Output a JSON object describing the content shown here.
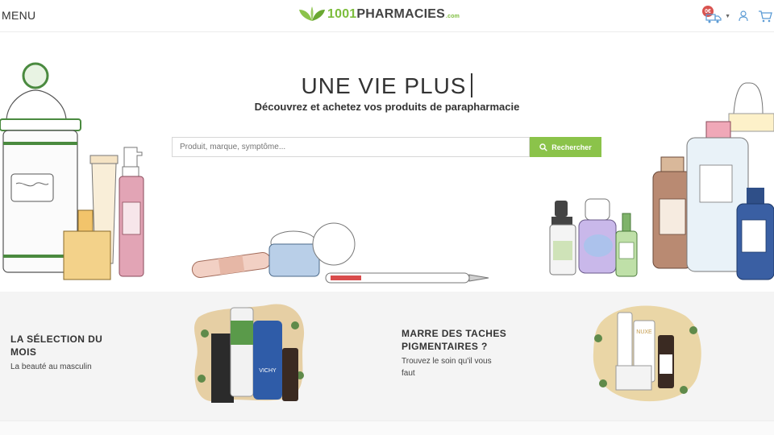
{
  "header": {
    "menu_label": "MENU",
    "logo": {
      "number": "1001",
      "word": "PHARMACIES",
      "suffix": ".com"
    },
    "badge_label": "0€",
    "icons": [
      "delivery-truck-icon",
      "user-icon",
      "cart-icon"
    ]
  },
  "hero": {
    "title": "UNE VIE PLUS",
    "subtitle": "Découvrez et achetez vos produits de parapharmacie",
    "search": {
      "placeholder": "Produit, marque, symptôme...",
      "button_label": "Rechercher"
    }
  },
  "selections": [
    {
      "title_line1": "LA SÉLECTION DU",
      "title_line2": "MOIS",
      "description": "La beauté au masculin"
    },
    {
      "title_line1": "MARRE DES TACHES",
      "title_line2": "PIGMENTAIRES ?",
      "description_line1": "Trouvez le soin qu'il vous",
      "description_line2": "faut"
    }
  ],
  "product_labels": {
    "brand_a": "VICHY",
    "brand_b": "NUXE"
  },
  "colors": {
    "brand_green": "#8bc34a",
    "badge_red": "#d9534f",
    "band_bg": "#f4f4f4"
  }
}
